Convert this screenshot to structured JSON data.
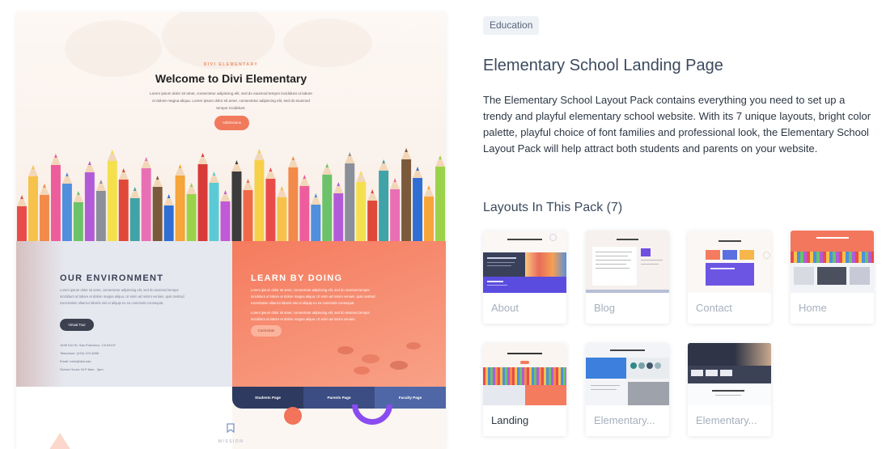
{
  "preview": {
    "eyebrow": "DIVI ELEMENTARY",
    "title": "Welcome to Divi Elementary",
    "hero_text": "Lorem ipsum dolor sit amet, consectetur adipiscing elit, sed do eiusmod tempor incididunt ut labore et dolore magna aliqua. Lorem ipsum dolor sit amet, consectetur adipiscing elit, sed do eiusmod tempor incididunt.",
    "hero_button": "Admissions",
    "env_title": "OUR ENVIRONMENT",
    "env_text": "Lorem ipsum dolor sit amet, consectetur adipiscing elit, sed do eiusmod tempor incididunt ut labore et dolore magna aliqua. Ut enim ad minim veniam, quis nostrud exercitation ullamco laboris nisi ut aliquip ex ea commodo consequat.",
    "env_button": "Virtual Tour",
    "env_address": "1545 Divi St. San Francisco, CA 94107",
    "env_phone": "Telephone: (415) 123-4566",
    "env_email": "Email: hello@divi.edu",
    "env_hours": "School Hours: M-F 8am - 3pm",
    "learn_title": "LEARN BY DOING",
    "learn_text": "Lorem ipsum dolor sit amet, consectetur adipiscing elit, sed do eiusmod tempor incididunt ut labore et dolore magna aliqua. Ut enim ad minim veniam, quis nostrud exercitation ullamco laboris nisi ut aliquip ex ea commodo consequat.",
    "learn_text2": "Lorem ipsum dolor sit amet, consectetur adipiscing elit, sed do eiusmod tempor incididunt ut labore et dolore magna aliqua. Ut enim ad minim veniam.",
    "learn_button": "Curriculum",
    "tabs": [
      "Students Page",
      "Parents Page",
      "Faculty Page"
    ],
    "mission": "MISSION"
  },
  "info": {
    "badge": "Education",
    "title": "Elementary School Landing Page",
    "description": "The Elementary School Layout Pack contains everything you need to set up a trendy and playful elementary school website. With its 7 unique layouts, bright color palette, playful choice of font families and professional look, the Elementary School Layout Pack will help attract both students and parents on your website.",
    "layouts_heading": "Layouts In This Pack (7)"
  },
  "layouts": [
    {
      "label": "About",
      "selected": false
    },
    {
      "label": "Blog",
      "selected": false
    },
    {
      "label": "Contact",
      "selected": false
    },
    {
      "label": "Home",
      "selected": false
    },
    {
      "label": "Landing",
      "selected": true
    },
    {
      "label": "Elementary...",
      "selected": false
    },
    {
      "label": "Elementary...",
      "selected": false
    }
  ],
  "colors": {
    "accent_orange": "#f27a5c",
    "accent_purple": "#8a4cf0",
    "heading": "#3c4a5e",
    "body": "#2d3744",
    "muted_label": "#a6afbd",
    "badge_bg": "#eef1f5"
  }
}
